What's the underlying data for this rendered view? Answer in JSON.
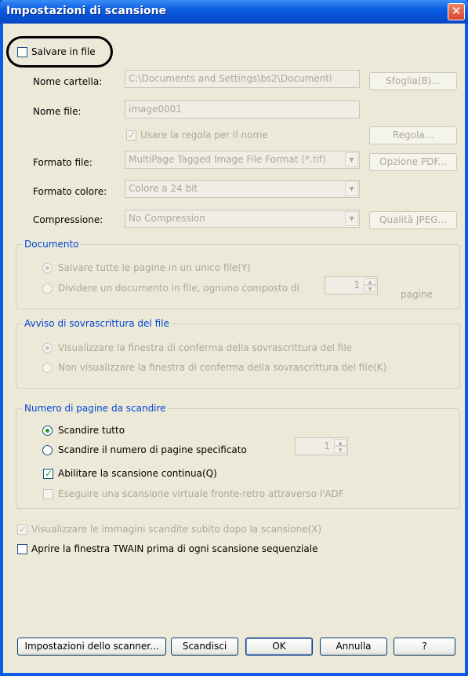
{
  "window": {
    "title": "Impostazioni di scansione",
    "close_glyph": "✕"
  },
  "save_to_file": {
    "label": "Salvare in file",
    "checked": false
  },
  "folder": {
    "label": "Nome cartella:",
    "value": "C:\\Documents and Settings\\bs2\\Documenti",
    "browse": "Sfoglia(B)..."
  },
  "filename": {
    "label": "Nome file:",
    "value": "image0001",
    "rule_label": "Usare la regola per il nome",
    "rule_checked": true,
    "rule_button": "Regola..."
  },
  "file_format": {
    "label": "Formato file:",
    "value": "MultiPage Tagged Image File Format (*.tif)",
    "button": "Opzione PDF..."
  },
  "color_format": {
    "label": "Formato colore:",
    "value": "Colore a 24 bit"
  },
  "compression": {
    "label": "Compressione:",
    "value": "No Compression",
    "button": "Qualità JPEG..."
  },
  "document": {
    "title": "Documento",
    "opt1": "Salvare tutte le pagine in un unico file(Y)",
    "opt2": "Dividere un documento in file, ognuno composto di",
    "pages_value": "1",
    "pages_unit": "pagine"
  },
  "overwrite": {
    "title": "Avviso di sovrascrittura del file",
    "opt1": "Visualizzare la finestra di conferma della sovrascrittura del file",
    "opt2": "Non visualizzare la finestra di conferma della sovrascrittura del file(K)"
  },
  "pages": {
    "title": "Numero di pagine da scandire",
    "opt_all": "Scandire tutto",
    "opt_specified": "Scandire il numero di pagine specificato",
    "count_value": "1",
    "continuous": "Abilitare la scansione continua(Q)",
    "continuous_checked": true,
    "virtual_duplex": "Eseguire una scansione virtuale fronte-retro attraverso l'ADF"
  },
  "show_images": {
    "label": "Visualizzare le immagini scandite subito dopo la scansione(X)",
    "checked": true
  },
  "open_twain": {
    "label": "Aprire la finestra TWAIN prima di ogni scansione sequenziale",
    "checked": false
  },
  "buttons": {
    "scanner_settings": "Impostazioni dello scanner...",
    "scan": "Scandisci",
    "ok": "OK",
    "cancel": "Annulla",
    "help": "?"
  },
  "colors": {
    "title_bar": "#0B5DE3",
    "group_title": "#0046D5",
    "check_green": "#21A121"
  }
}
